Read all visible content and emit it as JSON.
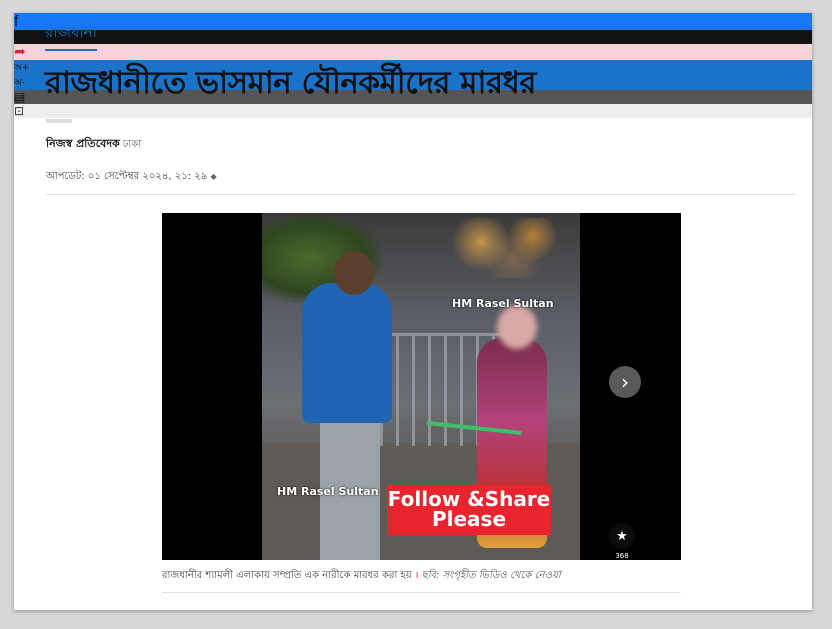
{
  "article": {
    "section": "রাজধানী",
    "headline": "রাজধানীতে ভাসমান যৌনকর্মীদের মারধর",
    "author": "নিজস্ব প্রতিবেদক",
    "location": "ঢাকা",
    "updated": "আপডেট: ০১ সেপ্টেম্বর ২০২৪, ২১: ২৯",
    "updated_icon": "chevron-updown-icon"
  },
  "share": {
    "buttons": [
      {
        "name": "facebook",
        "glyph": "f",
        "color": "#1877f2"
      },
      {
        "name": "x",
        "glyph": "𝕏",
        "color": "#111111"
      },
      {
        "name": "share",
        "glyph": "➦",
        "color": "#f4c9cf"
      },
      {
        "name": "font-increase",
        "glyph": "অ+",
        "color": "#1a73c9"
      },
      {
        "name": "font-decrease",
        "glyph": "অ-",
        "color": "#1a73c9"
      },
      {
        "name": "print",
        "glyph": "🖶",
        "color": "#555555"
      },
      {
        "name": "bookmark",
        "glyph": "🔖",
        "color": "#eeeeee"
      }
    ]
  },
  "media": {
    "watermark_top": "HM Rasel Sultan",
    "watermark_bottom": "HM Rasel Sultan",
    "overlay_line1": "Follow &Share",
    "overlay_line2": "Please",
    "like_count": "368",
    "next_glyph": "›",
    "like_glyph": "👍",
    "caption": "রাজধানীর শ্যামলী এলাকায় সম্প্রতি এক নারীকে মারধর করা হয়",
    "separator": "।",
    "credit": "ছবি: সংগৃহীত ভিডিও থেকে নেওয়া"
  }
}
